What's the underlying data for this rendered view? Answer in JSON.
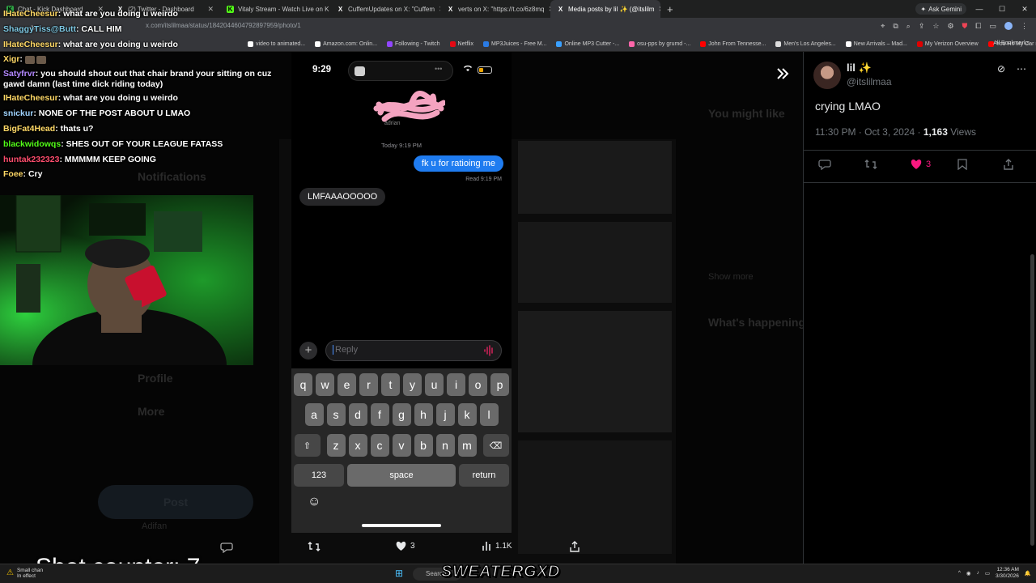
{
  "browser": {
    "tabs": [
      {
        "label": "Chat - Kick Dashboard",
        "color": "#2ea043",
        "glyph": "K"
      },
      {
        "label": "(2) Twitter - Dashboard",
        "color": "#555555",
        "glyph": "X"
      },
      {
        "label": "Vitaly Stream - Watch Live on K",
        "color": "#53fc18",
        "glyph": "K"
      },
      {
        "label": "CuffemUpdates on X: \"Cuffem",
        "color": "#555555",
        "glyph": "X"
      },
      {
        "label": "verts on X: \"https://t.co/6z8mq",
        "color": "#555555",
        "glyph": "X"
      },
      {
        "label": "Media posts by lil ✨ (@itslilm",
        "color": "#555555",
        "glyph": "X",
        "active": true
      }
    ],
    "ask_gemini": "Ask Gemini",
    "url": "x.com/itslilmaa/status/1842044604792897959/photo/1",
    "bookmarks": [
      {
        "label": "video to animated...",
        "color": "#ffffff"
      },
      {
        "label": "Amazon.com: Onlin...",
        "color": "#ffffff"
      },
      {
        "label": "Following - Twitch",
        "color": "#9146ff"
      },
      {
        "label": "Netflix",
        "color": "#e50914"
      },
      {
        "label": "MP3Juices - Free M...",
        "color": "#2a7be4"
      },
      {
        "label": "Online MP3 Cutter -...",
        "color": "#3aa0ff"
      },
      {
        "label": "osu-pps by grumd -...",
        "color": "#ff66aa"
      },
      {
        "label": "John From Tennesse...",
        "color": "#ff0000"
      },
      {
        "label": "Men's Los Angeles...",
        "color": "#dddddd"
      },
      {
        "label": "New Arrivals – Mad...",
        "color": "#ffffff"
      },
      {
        "label": "My Verizon Overview",
        "color": "#e00000"
      },
      {
        "label": "You Hit My Car reac...",
        "color": "#ff0000"
      }
    ],
    "all_bookmarks": "All Bookmarks"
  },
  "chat": [
    {
      "user": "IHateCheesur",
      "color": "#ffd966",
      "msg": "what are you doing u weirdo"
    },
    {
      "user": "ShaggyTiss@Butt",
      "color": "#7ec8e3",
      "msg": "CALL HIM"
    },
    {
      "user": "IHateCheesur",
      "color": "#ffd966",
      "msg": "what are you doing u weirdo"
    },
    {
      "user": "Xigr",
      "color": "#ffd966",
      "msg": ""
    },
    {
      "user": "Satyfrvr",
      "color": "#b388ff",
      "msg": "you should shout out that chair brand your sitting on cuz gawd damn (last time dick riding today)"
    },
    {
      "user": "IHateCheesur",
      "color": "#ffd966",
      "msg": "what are you doing u weirdo"
    },
    {
      "user": "snickur",
      "color": "#9fd3ff",
      "msg": "NONE OF THE POST ABOUT U LMAO"
    },
    {
      "user": "BigFat4Head",
      "color": "#ffd966",
      "msg": "thats u?"
    },
    {
      "user": "blackwidowqs",
      "color": "#53fc18",
      "msg": "SHES OUT OF YOUR LEAGUE FATASS"
    },
    {
      "user": "huntak232323",
      "color": "#ff4d6d",
      "msg": "MMMMM KEEP GOING"
    },
    {
      "user": "Foee",
      "color": "#ffd966",
      "msg": "Cry"
    }
  ],
  "background_nav": {
    "notifications": "Notifications",
    "profile": "Profile",
    "more": "More",
    "post": "Post",
    "account": "Adifan",
    "you_might_like": "You might like",
    "whats_happening": "What's happening",
    "show_more": "Show more"
  },
  "phone": {
    "time": "9:29",
    "contact": "adrian",
    "day_stamp": "Today 9:19 PM",
    "sent": "fk u for ratioing me",
    "read": "Read 9:19 PM",
    "received": "LMFAAAOOOOO",
    "reply_placeholder": "Reply",
    "keys_row1": [
      "q",
      "w",
      "e",
      "r",
      "t",
      "y",
      "u",
      "i",
      "o",
      "p"
    ],
    "keys_row2": [
      "a",
      "s",
      "d",
      "f",
      "g",
      "h",
      "j",
      "k",
      "l"
    ],
    "keys_row3": [
      "z",
      "x",
      "c",
      "v",
      "b",
      "n",
      "m"
    ],
    "key_123": "123",
    "key_space": "space",
    "key_return": "return"
  },
  "media_actions": {
    "likes": "3",
    "views": "1.1K"
  },
  "overlay": {
    "shot_counter": "Shot counter: 7",
    "brand": "SWEATERGXD"
  },
  "tweet": {
    "name": "lil ✨",
    "handle": "@itslilmaa",
    "text": "crying LMAO",
    "time": "11:30 PM · Oct 3, 2024 · ",
    "views_count": "1,163",
    "views_label": " Views",
    "likes": "3",
    "accent": "#f91880"
  },
  "taskbar": {
    "notice_line1": "Small chan",
    "notice_line2": "In effect",
    "search": "Search",
    "time": "12:36 AM",
    "date": "3/30/2026"
  }
}
